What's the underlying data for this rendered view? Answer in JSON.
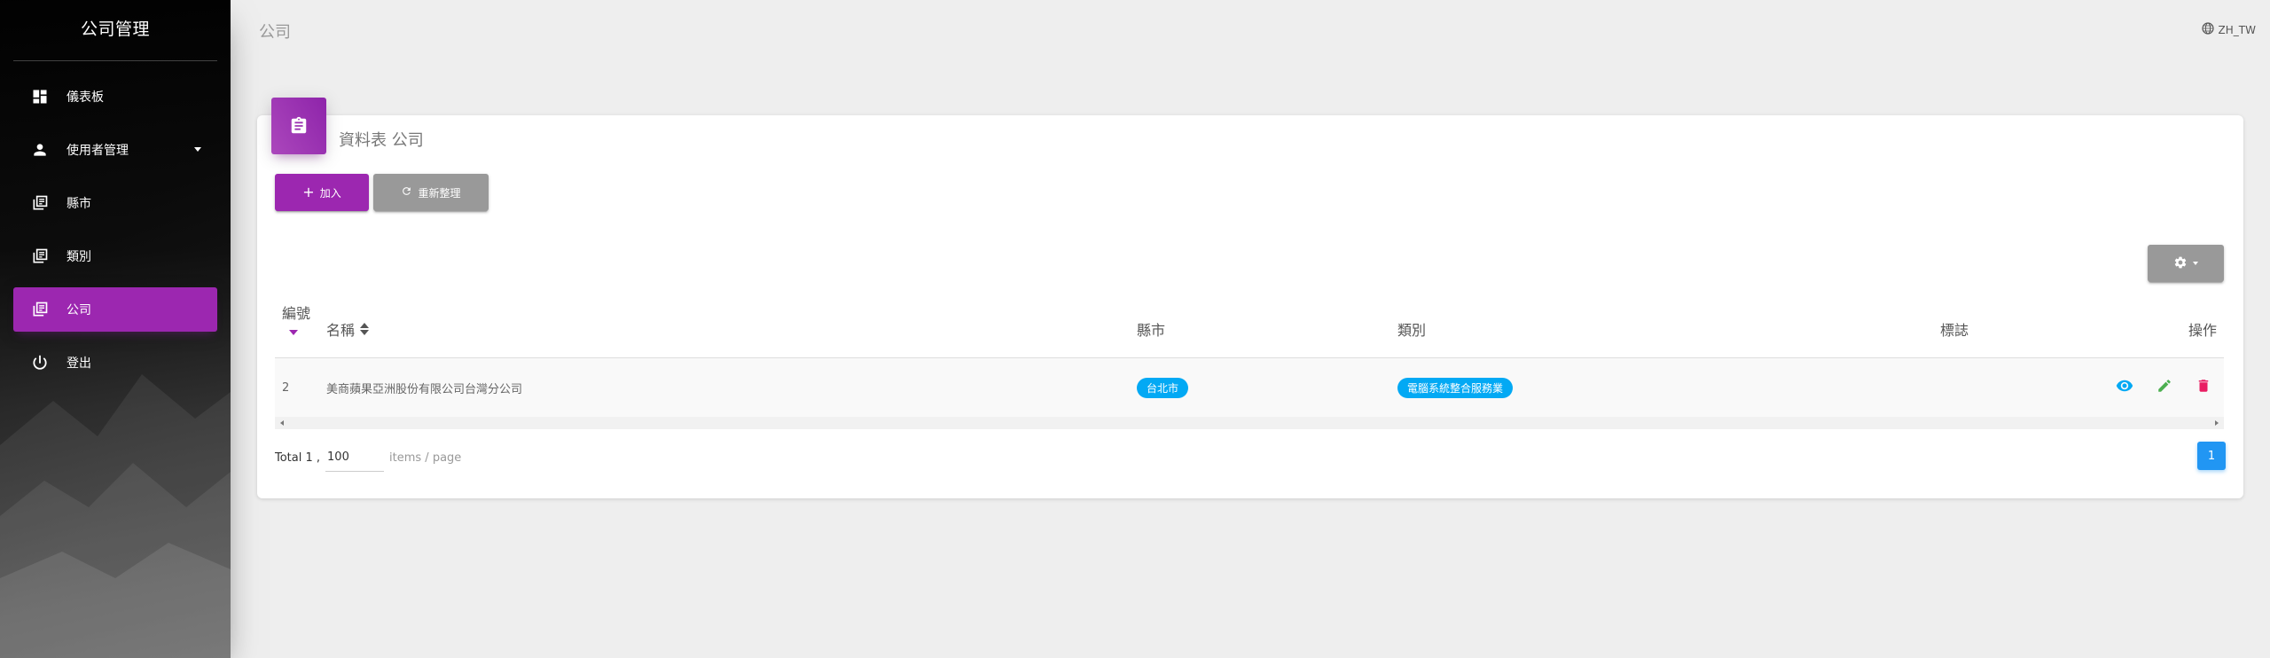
{
  "sidebar": {
    "title": "公司管理",
    "items": [
      {
        "label": "儀表板",
        "icon": "dashboard-icon"
      },
      {
        "label": "使用者管理",
        "icon": "person-icon"
      },
      {
        "label": "縣市",
        "icon": "library-icon"
      },
      {
        "label": "類別",
        "icon": "library-icon"
      },
      {
        "label": "公司",
        "icon": "library-icon",
        "active": true
      },
      {
        "label": "登出",
        "icon": "power-icon"
      }
    ]
  },
  "header": {
    "title": "公司",
    "language": "ZH_TW"
  },
  "card": {
    "title": "資料表 公司",
    "add_label": "加入",
    "refresh_label": "重新整理"
  },
  "table": {
    "columns": {
      "id": "編號",
      "name": "名稱",
      "city": "縣市",
      "category": "類別",
      "logo": "標誌",
      "actions": "操作"
    },
    "rows": [
      {
        "id": "2",
        "name": "美商蘋果亞洲股份有限公司台灣分公司",
        "city": "台北市",
        "category": "電腦系統整合服務業",
        "logo": ""
      }
    ]
  },
  "pagination": {
    "total_label": "Total 1 ,",
    "page_size": "100",
    "per_page_label": "items / page",
    "current_page": "1"
  },
  "colors": {
    "primary": "#9c27b0",
    "info": "#03a9f4",
    "view": "#03a9f4",
    "edit": "#4caf50",
    "delete": "#e91e63",
    "neutral": "#999999"
  }
}
